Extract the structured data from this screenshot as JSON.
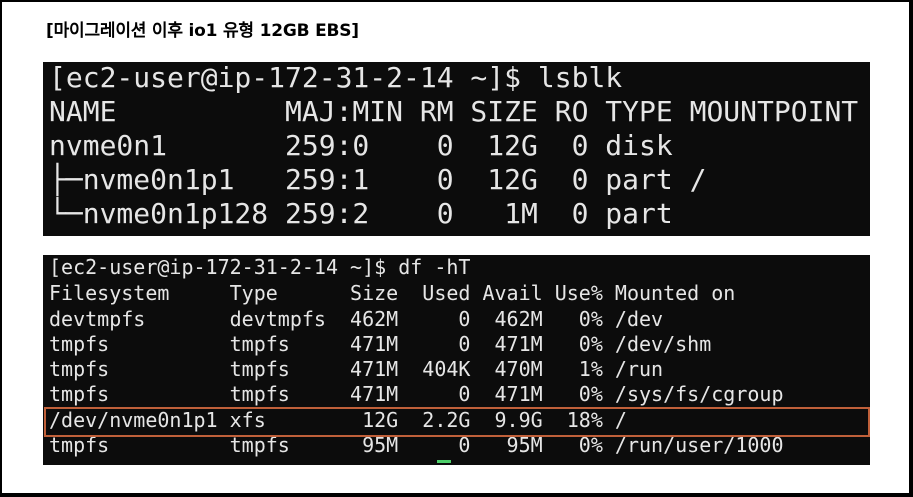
{
  "caption": "[마이그레이션 이후 io1 유형 12GB EBS]",
  "lsblk": {
    "lines": [
      "[ec2-user@ip-172-31-2-14 ~]$ lsblk",
      "NAME          MAJ:MIN RM SIZE RO TYPE MOUNTPOINT",
      "nvme0n1       259:0    0  12G  0 disk",
      "├─nvme0n1p1   259:1    0  12G  0 part /",
      "└─nvme0n1p128 259:2    0   1M  0 part"
    ]
  },
  "df": {
    "lines": [
      "[ec2-user@ip-172-31-2-14 ~]$ df -hT",
      "Filesystem     Type      Size  Used Avail Use% Mounted on",
      "devtmpfs       devtmpfs  462M     0  462M   0% /dev",
      "tmpfs          tmpfs     471M     0  471M   0% /dev/shm",
      "tmpfs          tmpfs     471M  404K  470M   1% /run",
      "tmpfs          tmpfs     471M     0  471M   0% /sys/fs/cgroup",
      "/dev/nvme0n1p1 xfs        12G  2.2G  9.9G  18% /",
      "tmpfs          tmpfs      95M     0   95M   0% /run/user/1000"
    ],
    "highlighted_row": "/dev/nvme0n1p1",
    "highlight_color": "#c0603a"
  },
  "colors": {
    "terminal_bg": "#0c0c0c",
    "terminal_fg": "#e6e6e6",
    "cursor": "#4dcf6a"
  }
}
